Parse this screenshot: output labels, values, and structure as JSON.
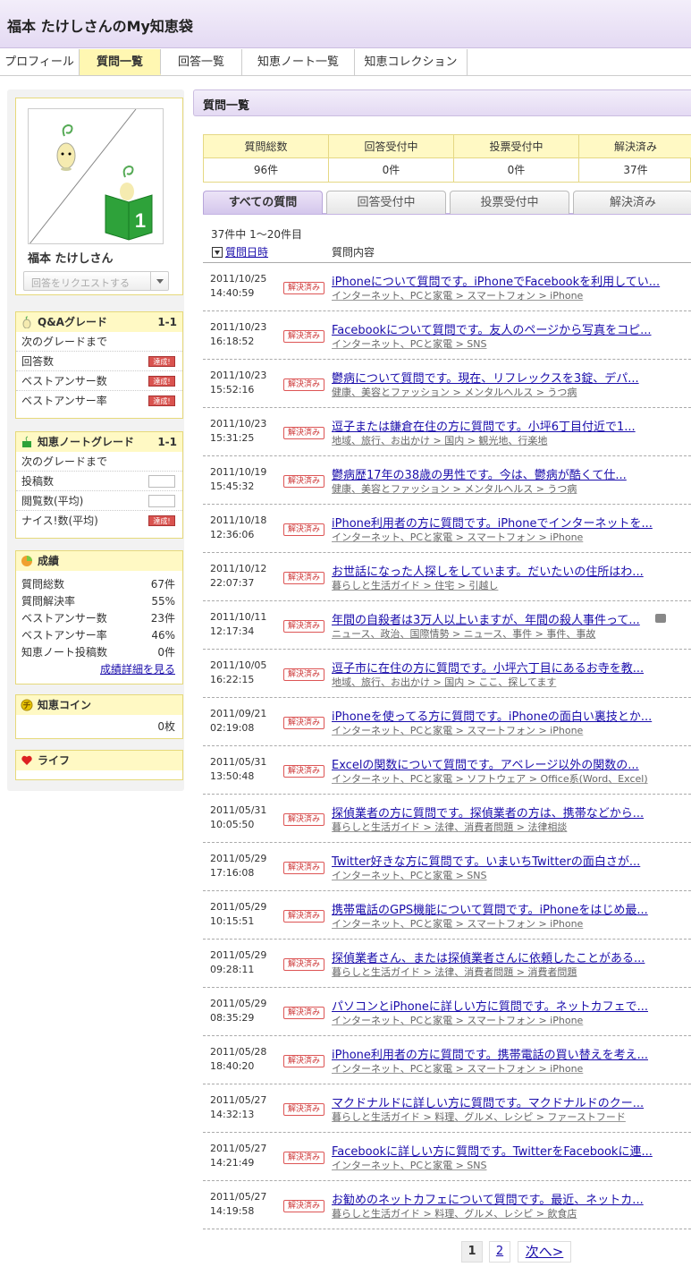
{
  "header": {
    "title": "福本 たけしさんのMy知恵袋"
  },
  "tabs": [
    "プロフィール",
    "質問一覧",
    "回答一覧",
    "知恵ノート一覧",
    "知恵コレクション"
  ],
  "profile": {
    "name": "福本 たけしさん",
    "request_button": "回答をリクエストする"
  },
  "qa_grade": {
    "title": "Q&Aグレード",
    "grade": "1-1",
    "next": "次のグレードまで",
    "rows": [
      {
        "label": "回答数",
        "badge": "達成!"
      },
      {
        "label": "ベストアンサー数",
        "badge": "達成!"
      },
      {
        "label": "ベストアンサー率",
        "badge": "達成!"
      }
    ]
  },
  "note_grade": {
    "title": "知恵ノートグレード",
    "grade": "1-1",
    "next": "次のグレードまで",
    "rows": [
      {
        "label": "投稿数",
        "badge": ""
      },
      {
        "label": "閲覧数(平均)",
        "badge": ""
      },
      {
        "label": "ナイス!数(平均)",
        "badge": "達成!"
      }
    ]
  },
  "results": {
    "title": "成績",
    "rows": [
      {
        "label": "質問総数",
        "value": "67件"
      },
      {
        "label": "質問解決率",
        "value": "55%"
      },
      {
        "label": "ベストアンサー数",
        "value": "23件"
      },
      {
        "label": "ベストアンサー率",
        "value": "46%"
      },
      {
        "label": "知恵ノート投稿数",
        "value": "0件"
      }
    ],
    "detail_link": "成績詳細を見る"
  },
  "coin": {
    "title": "知恵コイン",
    "value": "0枚"
  },
  "life": {
    "title": "ライフ"
  },
  "main": {
    "title": "質問一覧",
    "summary": [
      {
        "label": "質問総数",
        "value": "96件"
      },
      {
        "label": "回答受付中",
        "value": "0件"
      },
      {
        "label": "投票受付中",
        "value": "0件"
      },
      {
        "label": "解決済み",
        "value": "37件"
      }
    ],
    "filter_tabs": [
      "すべての質問",
      "回答受付中",
      "投票受付中",
      "解決済み"
    ],
    "count_text": "37件中 1〜20件目",
    "col_date": "質問日時",
    "col_content": "質問内容",
    "status_label": "解決済み",
    "questions": [
      {
        "date": "2011/10/25",
        "time": "14:40:59",
        "title": "iPhoneについて質問です。iPhoneでFacebookを利用してい...",
        "category": "インターネット、PCと家電 > スマートフォン > iPhone"
      },
      {
        "date": "2011/10/23",
        "time": "16:18:52",
        "title": "Facebookについて質問です。友人のページから写真をコピ...",
        "category": "インターネット、PCと家電 > SNS"
      },
      {
        "date": "2011/10/23",
        "time": "15:52:16",
        "title": "鬱病について質問です。現在、リフレックスを3錠、デパ...",
        "category": "健康、美容とファッション > メンタルヘルス > うつ病"
      },
      {
        "date": "2011/10/23",
        "time": "15:31:25",
        "title": "逗子または鎌倉在住の方に質問です。小坪6丁目付近で1...",
        "category": "地域、旅行、お出かけ > 国内 > 観光地、行楽地"
      },
      {
        "date": "2011/10/19",
        "time": "15:45:32",
        "title": "鬱病歴17年の38歳の男性です。今は、鬱病が酷くて仕...",
        "category": "健康、美容とファッション > メンタルヘルス > うつ病"
      },
      {
        "date": "2011/10/18",
        "time": "12:36:06",
        "title": "iPhone利用者の方に質問です。iPhoneでインターネットを...",
        "category": "インターネット、PCと家電 > スマートフォン > iPhone"
      },
      {
        "date": "2011/10/12",
        "time": "22:07:37",
        "title": "お世話になった人探しをしています。だいたいの住所はわ...",
        "category": "暮らしと生活ガイド > 住宅 > 引越し"
      },
      {
        "date": "2011/10/11",
        "time": "12:17:34",
        "title": "年間の自殺者は3万人以上いますが、年間の殺人事件って...",
        "category": "ニュース、政治、国際情勢 > ニュース、事件 > 事件、事故",
        "photo": true
      },
      {
        "date": "2011/10/05",
        "time": "16:22:15",
        "title": "逗子市に在住の方に質問です。小坪六丁目にあるお寺を教...",
        "category": "地域、旅行、お出かけ > 国内 > ここ、探してます"
      },
      {
        "date": "2011/09/21",
        "time": "02:19:08",
        "title": "iPhoneを使ってる方に質問です。iPhoneの面白い裏技とか...",
        "category": "インターネット、PCと家電 > スマートフォン > iPhone"
      },
      {
        "date": "2011/05/31",
        "time": "13:50:48",
        "title": "Excelの関数について質問です。アベレージ以外の関数の...",
        "category": "インターネット、PCと家電 > ソフトウェア > Office系(Word、Excel)"
      },
      {
        "date": "2011/05/31",
        "time": "10:05:50",
        "title": "探偵業者の方に質問です。探偵業者の方は、携帯などから...",
        "category": "暮らしと生活ガイド > 法律、消費者問題 > 法律相談"
      },
      {
        "date": "2011/05/29",
        "time": "17:16:08",
        "title": "Twitter好きな方に質問です。いまいちTwitterの面白さが...",
        "category": "インターネット、PCと家電 > SNS"
      },
      {
        "date": "2011/05/29",
        "time": "10:15:51",
        "title": "携帯電話のGPS機能について質問です。iPhoneをはじめ最...",
        "category": "インターネット、PCと家電 > スマートフォン > iPhone"
      },
      {
        "date": "2011/05/29",
        "time": "09:28:11",
        "title": "探偵業者さん、または探偵業者さんに依頼したことがある...",
        "category": "暮らしと生活ガイド > 法律、消費者問題 > 消費者問題"
      },
      {
        "date": "2011/05/29",
        "time": "08:35:29",
        "title": "パソコンとiPhoneに詳しい方に質問です。ネットカフェで...",
        "category": "インターネット、PCと家電 > スマートフォン > iPhone"
      },
      {
        "date": "2011/05/28",
        "time": "18:40:20",
        "title": "iPhone利用者の方に質問です。携帯電話の買い替えを考え...",
        "category": "インターネット、PCと家電 > スマートフォン > iPhone"
      },
      {
        "date": "2011/05/27",
        "time": "14:32:13",
        "title": "マクドナルドに詳しい方に質問です。マクドナルドのクー...",
        "category": "暮らしと生活ガイド > 料理、グルメ、レシピ > ファーストフード"
      },
      {
        "date": "2011/05/27",
        "time": "14:21:49",
        "title": "Facebookに詳しい方に質問です。TwitterをFacebookに連...",
        "category": "インターネット、PCと家電 > SNS"
      },
      {
        "date": "2011/05/27",
        "time": "14:19:58",
        "title": "お勧めのネットカフェについて質問です。最近、ネットカ...",
        "category": "暮らしと生活ガイド > 料理、グルメ、レシピ > 飲食店"
      }
    ],
    "pager": {
      "current": "1",
      "page2": "2",
      "next": "次へ>"
    }
  }
}
